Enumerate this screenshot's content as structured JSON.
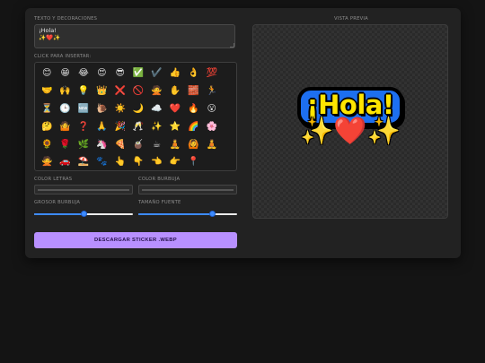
{
  "editor": {
    "text_label": "TEXTO Y DECORACIONES",
    "text_value": "¡Hola!\n✨❤️✨",
    "emoji_label": "CLICK PARA INSERTAR:",
    "emojis": [
      "😊",
      "😁",
      "😂",
      "😍",
      "😎",
      "✅",
      "✔️",
      "👍",
      "👌",
      "💯",
      "🤝",
      "🙌",
      "💡",
      "👑",
      "❌",
      "🚫",
      "🙅",
      "✋",
      "🧱",
      "🏃",
      "⏳",
      "🕒",
      "🆕",
      "🐌",
      "☀️",
      "🌙",
      "☁️",
      "❤️",
      "🔥",
      "😮",
      "🤔",
      "🤷",
      "❓",
      "🙏",
      "🎉",
      "🥂",
      "✨",
      "⭐",
      "🌈",
      "🌸",
      "🌻",
      "🌹",
      "🌿",
      "🦄",
      "🍕",
      "🧉",
      "☕",
      "🧘",
      "🙆",
      "🧘",
      "🙅",
      "🚗",
      "⛱️",
      "🐾",
      "👆",
      "👇",
      "👈",
      "👉",
      "📍",
      ""
    ],
    "color_text_label": "COLOR LETRAS",
    "color_bubble_label": "COLOR BURBUJA",
    "bubble_thickness_label": "GROSOR BURBUJA",
    "font_size_label": "TAMAÑO FUENTE",
    "bubble_thickness_value": 0.5,
    "font_size_value": 0.75,
    "text_color": "#ffe500",
    "bubble_color": "#1d6ff0",
    "download_label": "DESCARGAR STICKER .WEBP"
  },
  "preview": {
    "label": "VISTA PREVIA",
    "sticker_line1": "¡Hola!",
    "sticker_line2_left": "✨",
    "sticker_line2_heart": "❤️",
    "sticker_line2_right": "✨"
  },
  "colors": {
    "accent": "#b890ff",
    "slider": "#3d8bfd",
    "panel": "#222222"
  }
}
